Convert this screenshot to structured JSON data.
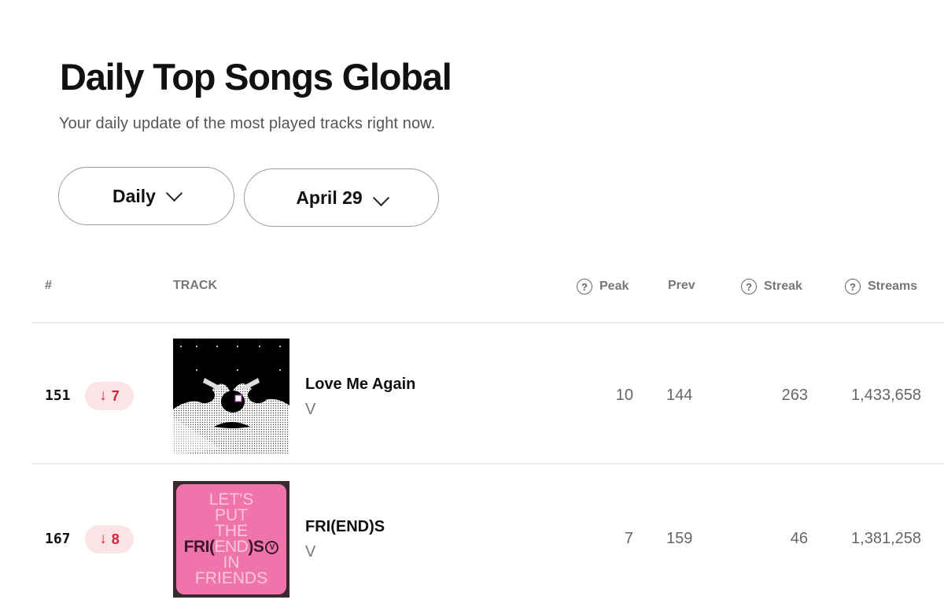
{
  "page": {
    "title": "Daily Top Songs Global",
    "subtitle": "Your daily update of the most played tracks right now."
  },
  "filters": {
    "frequency": {
      "label": "Daily",
      "icon": "chevron-down-icon"
    },
    "date": {
      "label": "April 29",
      "icon": "chevron-down-icon"
    }
  },
  "table": {
    "columns": {
      "rank": "#",
      "track": "TRACK",
      "peak": "Peak",
      "prev": "Prev",
      "streak": "Streak",
      "streams": "Streams"
    },
    "help_icon_glyph": "?",
    "rows": [
      {
        "rank": "151",
        "change_direction": "down",
        "change_arrow": "↓",
        "change_value": "7",
        "title": "Love Me Again",
        "artist": "V",
        "peak": "10",
        "prev": "144",
        "streak": "263",
        "streams": "1,433,658"
      },
      {
        "rank": "167",
        "change_direction": "down",
        "change_arrow": "↓",
        "change_value": "8",
        "title": "FRI(END)S",
        "artist": "V",
        "peak": "7",
        "prev": "159",
        "streak": "46",
        "streams": "1,381,258",
        "cover_text": {
          "lines": [
            "LET'S",
            "PUT",
            "THE"
          ],
          "highlight_pre": "FRI(",
          "highlight_mid": "END",
          "highlight_post": ")S",
          "logo": "V",
          "bottom": [
            "IN",
            "FRIENDS"
          ]
        }
      }
    ]
  },
  "colors": {
    "change_down": "#d4203a",
    "change_badge_bg": "#fbe4e6",
    "cover_pink": "#ef74ab"
  }
}
